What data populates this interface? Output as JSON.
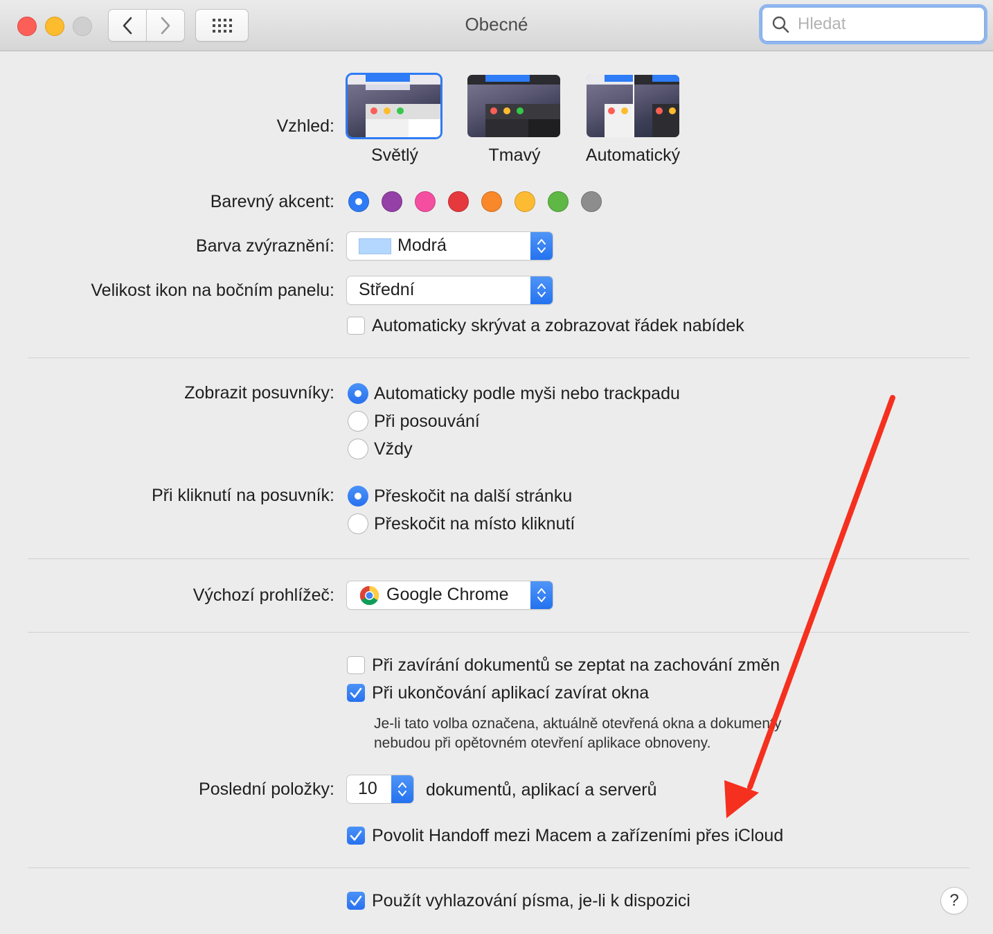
{
  "window": {
    "title": "Obecné"
  },
  "search": {
    "placeholder": "Hledat"
  },
  "appearance": {
    "label": "Vzhled:",
    "options": [
      "Světlý",
      "Tmavý",
      "Automatický"
    ],
    "selected": "Světlý"
  },
  "accent": {
    "label": "Barevný akcent:",
    "colors": [
      "#2f7bf5",
      "#9440a7",
      "#f54ea0",
      "#e5393e",
      "#f88829",
      "#fdbb34",
      "#5fb745",
      "#8d8d8d"
    ],
    "selected_index": 0
  },
  "highlight": {
    "label": "Barva zvýraznění:",
    "value": "Modrá",
    "swatch": "#b3d7ff"
  },
  "sidebar_icons": {
    "label": "Velikost ikon na bočním panelu:",
    "value": "Střední"
  },
  "menubar": {
    "label": "Automaticky skrývat a zobrazovat řádek nabídek",
    "checked": false
  },
  "scrollbars": {
    "label": "Zobrazit posuvníky:",
    "options": [
      "Automaticky podle myši nebo trackpadu",
      "Při posouvání",
      "Vždy"
    ],
    "selected_index": 0
  },
  "scroll_click": {
    "label": "Při kliknutí na posuvník:",
    "options": [
      "Přeskočit na další stránku",
      "Přeskočit na místo kliknutí"
    ],
    "selected_index": 0
  },
  "browser": {
    "label": "Výchozí prohlížeč:",
    "value": "Google Chrome"
  },
  "ask_keep_changes": {
    "label": "Při zavírání dokumentů se zeptat na zachování změn",
    "checked": false
  },
  "close_windows": {
    "label": "Při ukončování aplikací zavírat okna",
    "checked": true,
    "note_line1": "Je-li tato volba označena, aktuálně otevřená okna a dokumenty",
    "note_line2": "nebudou při opětovném otevření aplikace obnoveny."
  },
  "recent_items": {
    "label": "Poslední položky:",
    "value": "10",
    "suffix": "dokumentů, aplikací a serverů"
  },
  "handoff": {
    "label": "Povolit Handoff mezi Macem a zařízeními přes iCloud",
    "checked": true
  },
  "font_smoothing": {
    "label": "Použít vyhlazování písma, je-li k dispozici",
    "checked": true
  },
  "help": {
    "label": "?"
  },
  "annotation": {
    "color": "#f5301f"
  }
}
